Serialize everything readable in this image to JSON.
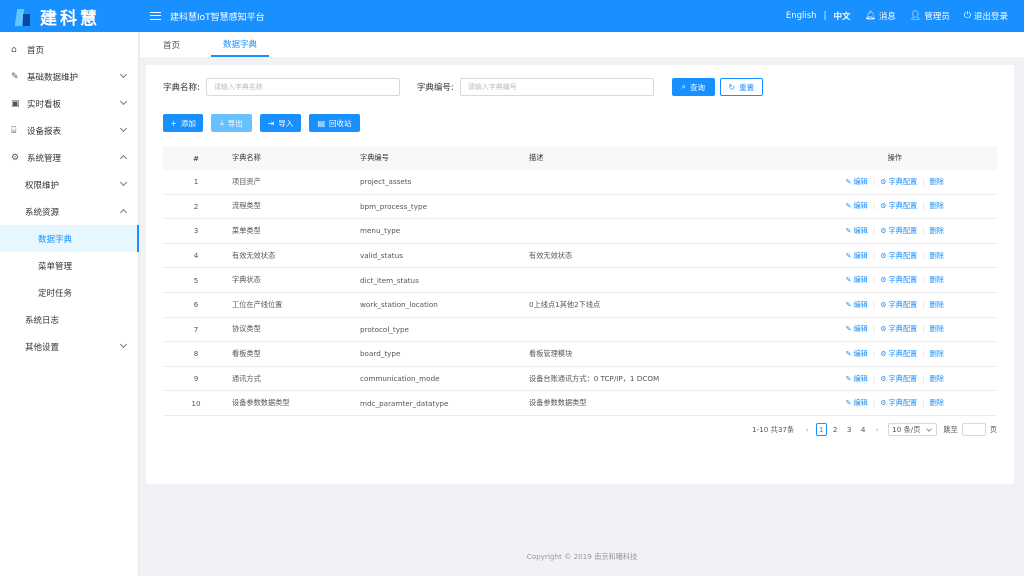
{
  "brand": {
    "name": "建科慧"
  },
  "header": {
    "platform_title": "建科慧IoT智慧感知平台",
    "lang_en": "English",
    "lang_sep": "|",
    "lang_cn": "中文",
    "messages": "消息",
    "admin": "管理员",
    "logout": "退出登录"
  },
  "sidebar": {
    "home": "首页",
    "basic_data": "基础数据维护",
    "realtime": "实时看板",
    "device_report": "设备报表",
    "system_mgmt": "系统管理",
    "permission": "权限维护",
    "system_resource": "系统资源",
    "data_dict": "数据字典",
    "menu_mgmt": "菜单管理",
    "scheduled_tasks": "定时任务",
    "system_log": "系统日志",
    "other_settings": "其他设置"
  },
  "tabs": {
    "home": "首页",
    "data_dict": "数据字典"
  },
  "search": {
    "name_label": "字典名称:",
    "name_placeholder": "请输入字典名称",
    "code_label": "字典编号:",
    "code_placeholder": "请输入字典编号",
    "query_label": "查询",
    "reset_label": "重置"
  },
  "toolbar": {
    "add": "添加",
    "export": "导出",
    "import": "导入",
    "recycle": "回收站"
  },
  "table": {
    "headers": {
      "index": "#",
      "name": "字典名称",
      "code": "字典编号",
      "desc": "描述",
      "ops": "操作"
    },
    "op_labels": {
      "edit": "编辑",
      "config": "字典配置",
      "delete": "删除"
    },
    "rows": [
      {
        "index": "1",
        "name": "项目资产",
        "code": "project_assets",
        "desc": ""
      },
      {
        "index": "2",
        "name": "流程类型",
        "code": "bpm_process_type",
        "desc": ""
      },
      {
        "index": "3",
        "name": "菜单类型",
        "code": "menu_type",
        "desc": ""
      },
      {
        "index": "4",
        "name": "有效无效状态",
        "code": "valid_status",
        "desc": "有效无效状态"
      },
      {
        "index": "5",
        "name": "字典状态",
        "code": "dict_item_status",
        "desc": ""
      },
      {
        "index": "6",
        "name": "工位在产线位置",
        "code": "work_station_location",
        "desc": "0上线点1其他2下线点"
      },
      {
        "index": "7",
        "name": "协议类型",
        "code": "protocol_type",
        "desc": ""
      },
      {
        "index": "8",
        "name": "看板类型",
        "code": "board_type",
        "desc": "看板管理模块"
      },
      {
        "index": "9",
        "name": "通讯方式",
        "code": "communication_mode",
        "desc": "设备台账通讯方式：0 TCP/IP，1 DCOM"
      },
      {
        "index": "10",
        "name": "设备参数数据类型",
        "code": "mdc_paramter_datatype",
        "desc": "设备参数数据类型"
      }
    ]
  },
  "pagination": {
    "summary": "1-10 共37条",
    "pages": [
      "1",
      "2",
      "3",
      "4"
    ],
    "current_page": "1",
    "page_size": "10 条/页",
    "jump_label": "跳至",
    "page_suffix": "页"
  },
  "footer": {
    "copyright": "Copyright © 2019 南京和曦科技"
  },
  "colors": {
    "primary": "#1890ff",
    "light_primary": "#69c0ff",
    "background": "#f0f2f5"
  }
}
